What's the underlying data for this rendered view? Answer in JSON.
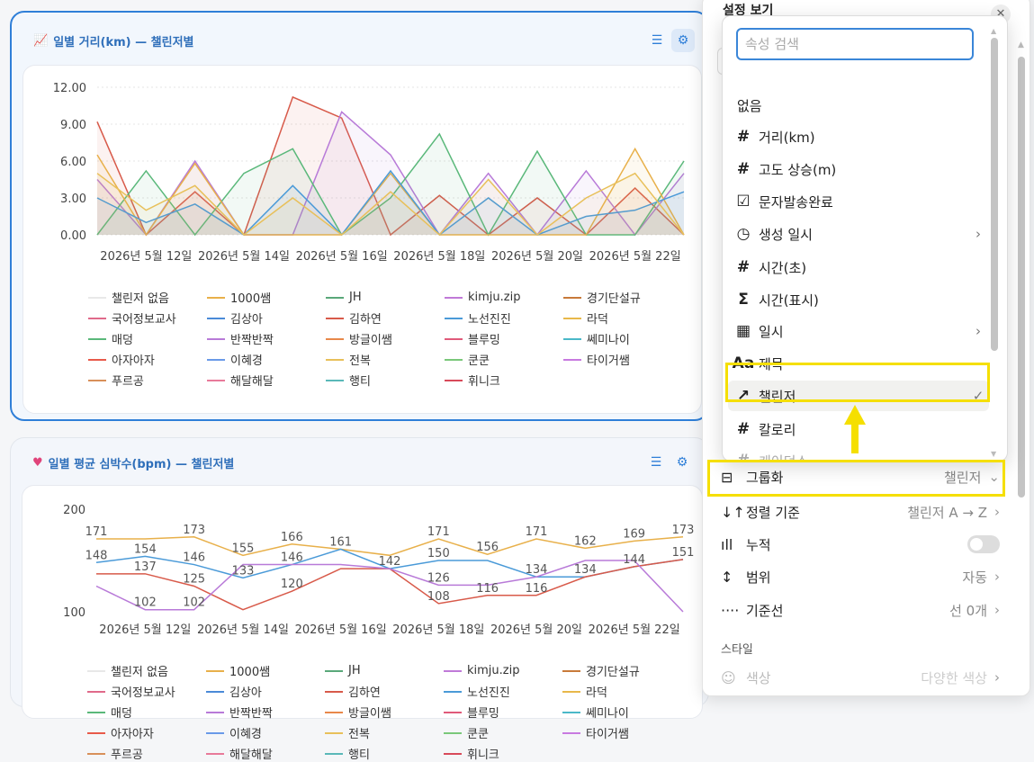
{
  "colors": {
    "accent": "#2f7fd8",
    "highlight": "#f5df00"
  },
  "card_distance": {
    "title": "일별 거리(km) — 챌린저별",
    "icon": "chart-line-icon",
    "filter_icon": "filter-icon",
    "settings_icon": "sliders-icon"
  },
  "card_heartrate": {
    "title": "일별 평균 심박수(bpm) — 챌린저별",
    "icon": "heart-icon",
    "filter_icon": "filter-icon",
    "settings_icon": "sliders-icon"
  },
  "legend": [
    "챌린저 없음",
    "1000쌤",
    "JH",
    "kimju.zip",
    "경기단설규",
    "국어정보교사",
    "김상아",
    "김하연",
    "노선진진",
    "라덕",
    "매덩",
    "반짝반짝",
    "방글이쌤",
    "블루밍",
    "쎄미나이",
    "아자아자",
    "이혜경",
    "전복",
    "쿤쿤",
    "타이거쌤",
    "푸르공",
    "해달해달",
    "행티",
    "휘니크"
  ],
  "legend_colors": [
    "#e8e8e8",
    "#e8b04a",
    "#5aa87a",
    "#c07ad8",
    "#c87a3a",
    "#e06a8a",
    "#4a8ad8",
    "#d85a4a",
    "#4a9ad8",
    "#e8b84a",
    "#5ab87a",
    "#b87ad8",
    "#e8884a",
    "#e05a7a",
    "#4ab8c8",
    "#e85a4a",
    "#6a9ae8",
    "#e8c05a",
    "#7ac87a",
    "#c87ae0",
    "#d8905a",
    "#e87a9a",
    "#5ab8b8",
    "#d84a5a"
  ],
  "chart_data": [
    {
      "type": "area",
      "title": "일별 거리(km) — 챌린저별",
      "y_ticks": [
        "12.00",
        "9.00",
        "6.00",
        "3.00",
        "0.00"
      ],
      "ylim": [
        0,
        12
      ],
      "x_ticks": [
        "2026년 5월 12일",
        "2026년 5월 14일",
        "2026년 5월 16일",
        "2026년 5월 18일",
        "2026년 5월 20일",
        "2026년 5월 22일"
      ],
      "x": [
        11,
        12,
        13,
        14,
        15,
        16,
        17,
        18,
        19,
        20,
        21,
        22,
        23
      ],
      "series": [
        {
          "name": "김하연",
          "values": [
            9.2,
            0,
            3.5,
            0,
            11.2,
            9.5,
            0,
            3.2,
            0,
            3.0,
            0,
            3.8,
            0
          ]
        },
        {
          "name": "반짝반짝",
          "values": [
            4.5,
            0,
            6.0,
            0,
            0,
            10.0,
            6.5,
            0,
            5.0,
            0,
            5.2,
            0,
            5.0
          ]
        },
        {
          "name": "매덩",
          "values": [
            0,
            5.2,
            0,
            5.0,
            7.0,
            0,
            3.0,
            8.2,
            0,
            6.8,
            0,
            0,
            6.0
          ]
        },
        {
          "name": "1000쌤",
          "values": [
            6.5,
            0,
            5.8,
            0,
            0,
            0,
            5.0,
            0,
            0,
            0,
            0,
            7.0,
            0
          ]
        },
        {
          "name": "노선진진",
          "values": [
            3.0,
            1.0,
            2.5,
            0,
            4.0,
            0,
            5.2,
            0,
            3.0,
            0,
            1.5,
            2.0,
            3.5
          ]
        },
        {
          "name": "전복",
          "values": [
            5.0,
            2.0,
            4.0,
            0,
            3.0,
            0,
            3.5,
            0,
            4.5,
            0,
            3.0,
            5.0,
            0
          ]
        }
      ],
      "legend_position": "bottom"
    },
    {
      "type": "line",
      "title": "일별 평균 심박수(bpm) — 챌린저별",
      "y_ticks": [
        "200",
        "100"
      ],
      "ylim": [
        100,
        200
      ],
      "x_ticks": [
        "2026년 5월 12일",
        "2026년 5월 14일",
        "2026년 5월 16일",
        "2026년 5월 18일",
        "2026년 5월 20일",
        "2026년 5월 22일"
      ],
      "data_labels": [
        {
          "x": 11,
          "y": 171,
          "text": "171"
        },
        {
          "x": 11,
          "y": 148,
          "text": "148"
        },
        {
          "x": 12,
          "y": 154,
          "text": "154"
        },
        {
          "x": 12,
          "y": 137,
          "text": "137"
        },
        {
          "x": 12,
          "y": 102,
          "text": "102"
        },
        {
          "x": 13,
          "y": 173,
          "text": "173"
        },
        {
          "x": 13,
          "y": 146,
          "text": "146"
        },
        {
          "x": 13,
          "y": 125,
          "text": "125"
        },
        {
          "x": 13,
          "y": 102,
          "text": "102"
        },
        {
          "x": 14,
          "y": 155,
          "text": "155"
        },
        {
          "x": 14,
          "y": 133,
          "text": "133"
        },
        {
          "x": 15,
          "y": 166,
          "text": "166"
        },
        {
          "x": 15,
          "y": 146,
          "text": "146"
        },
        {
          "x": 15,
          "y": 120,
          "text": "120"
        },
        {
          "x": 16,
          "y": 161,
          "text": "161"
        },
        {
          "x": 17,
          "y": 142,
          "text": "142"
        },
        {
          "x": 18,
          "y": 171,
          "text": "171"
        },
        {
          "x": 18,
          "y": 150,
          "text": "150"
        },
        {
          "x": 18,
          "y": 126,
          "text": "126"
        },
        {
          "x": 18,
          "y": 108,
          "text": "108"
        },
        {
          "x": 19,
          "y": 156,
          "text": "156"
        },
        {
          "x": 19,
          "y": 116,
          "text": "116"
        },
        {
          "x": 20,
          "y": 171,
          "text": "171"
        },
        {
          "x": 20,
          "y": 134,
          "text": "134"
        },
        {
          "x": 20,
          "y": 116,
          "text": "116"
        },
        {
          "x": 21,
          "y": 162,
          "text": "162"
        },
        {
          "x": 21,
          "y": 134,
          "text": "134"
        },
        {
          "x": 22,
          "y": 169,
          "text": "169"
        },
        {
          "x": 22,
          "y": 144,
          "text": "144"
        },
        {
          "x": 23,
          "y": 173,
          "text": "173"
        },
        {
          "x": 23,
          "y": 151,
          "text": "151"
        }
      ],
      "series": [
        {
          "name": "1000쌤",
          "values": [
            171,
            171,
            173,
            155,
            166,
            161,
            155,
            171,
            156,
            171,
            162,
            169,
            173
          ]
        },
        {
          "name": "노선진진",
          "values": [
            148,
            154,
            146,
            133,
            146,
            161,
            142,
            150,
            150,
            134,
            134,
            144,
            151
          ]
        },
        {
          "name": "김하연",
          "values": [
            137,
            137,
            125,
            102,
            120,
            142,
            142,
            108,
            116,
            116,
            134,
            144,
            151
          ]
        },
        {
          "name": "반짝반짝",
          "values": [
            125,
            102,
            102,
            146,
            146,
            146,
            142,
            126,
            126,
            134,
            150,
            150,
            100
          ]
        }
      ]
    }
  ],
  "panel": {
    "title": "설정 보기",
    "close_icon": "close-icon"
  },
  "dropdown": {
    "search_placeholder": "속성 검색",
    "items": [
      {
        "label": "없음",
        "icon": "",
        "arrow": ""
      },
      {
        "label": "거리(km)",
        "icon": "#",
        "arrow": ""
      },
      {
        "label": "고도 상승(m)",
        "icon": "#",
        "arrow": ""
      },
      {
        "label": "문자발송완료",
        "icon": "☑",
        "arrow": ""
      },
      {
        "label": "생성 일시",
        "icon": "◷",
        "arrow": "›"
      },
      {
        "label": "시간(초)",
        "icon": "#",
        "arrow": ""
      },
      {
        "label": "시간(표시)",
        "icon": "Σ",
        "arrow": ""
      },
      {
        "label": "일시",
        "icon": "▦",
        "arrow": "›"
      },
      {
        "label": "제목",
        "icon": "Aa",
        "arrow": ""
      },
      {
        "label": "챌린저",
        "icon": "↗",
        "arrow": "✓"
      },
      {
        "label": "칼로리",
        "icon": "#",
        "arrow": ""
      },
      {
        "label": "케이던스",
        "icon": "#",
        "arrow": ""
      }
    ]
  },
  "settings": {
    "group": {
      "label": "그룹화",
      "value": "챌린저",
      "icon": "⊟",
      "arrow": "⌄"
    },
    "sort": {
      "label": "정렬 기준",
      "value": "챌린저 A → Z",
      "icon": "↓↑",
      "arrow": "›"
    },
    "stack": {
      "label": "누적",
      "icon": "ıll"
    },
    "range": {
      "label": "범위",
      "value": "자동",
      "icon": "↕",
      "arrow": "›"
    },
    "baseline": {
      "label": "기준선",
      "value": "선 0개",
      "icon": "····",
      "arrow": "›"
    },
    "style_heading": "스타일",
    "color": {
      "label": "색상",
      "value": "다양한 색상",
      "arrow": "›"
    }
  }
}
